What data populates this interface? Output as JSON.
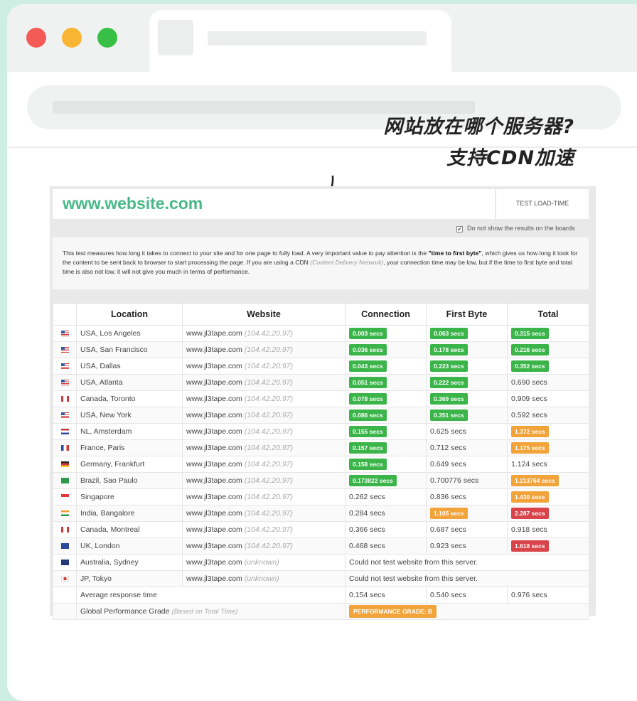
{
  "overlay": {
    "line1": "网站放在哪个服务器?",
    "line2": "支持CDN加速"
  },
  "panel": {
    "site_title": "www.website.com",
    "test_button": "TEST LOAD-TIME",
    "checkbox_label": "Do not show the results on the boards",
    "checkbox_checked": true,
    "info_pre": "This test measures how long it takes to connect to your site and for one page to fully load. A very important value to pay attention is the ",
    "info_bold": "\"time to first byte\"",
    "info_mid": ", which gives us how long it took for the content to be sent back to browser to start processing the page. If you are using a CDN ",
    "info_italic": "(Content Delivery Network)",
    "info_post": ", your connection time may be low, but if the time to first byte and total time is also not low, it will not give you much in terms of performance."
  },
  "table": {
    "headers": [
      "Location",
      "Website",
      "Connection",
      "First Byte",
      "Total"
    ],
    "rows": [
      {
        "flag": "us",
        "location": "USA, Los Angeles",
        "site": "www.jl3tape.com",
        "ip": "(104.42.20.97)",
        "conn": "0.003 secs",
        "conn_c": "green",
        "fb": "0.063 secs",
        "fb_c": "green",
        "total": "0.315 secs",
        "total_c": "green"
      },
      {
        "flag": "us",
        "location": "USA, San Francisco",
        "site": "www.jl3tape.com",
        "ip": "(104.42.20.97)",
        "conn": "0.036 secs",
        "conn_c": "green",
        "fb": "0.178 secs",
        "fb_c": "green",
        "total": "0.216 secs",
        "total_c": "green"
      },
      {
        "flag": "us",
        "location": "USA, Dallas",
        "site": "www.jl3tape.com",
        "ip": "(104.42.20.97)",
        "conn": "0.043 secs",
        "conn_c": "green",
        "fb": "0.223 secs",
        "fb_c": "green",
        "total": "0.352 secs",
        "total_c": "green"
      },
      {
        "flag": "us",
        "location": "USA, Atlanta",
        "site": "www.jl3tape.com",
        "ip": "(104.42.20.97)",
        "conn": "0.051 secs",
        "conn_c": "green",
        "fb": "0.222 secs",
        "fb_c": "green",
        "total": "0.690 secs",
        "total_c": ""
      },
      {
        "flag": "ca",
        "location": "Canada, Toronto",
        "site": "www.jl3tape.com",
        "ip": "(104.42.20.97)",
        "conn": "0.078 secs",
        "conn_c": "green",
        "fb": "0.369 secs",
        "fb_c": "green",
        "total": "0.909 secs",
        "total_c": ""
      },
      {
        "flag": "us",
        "location": "USA, New York",
        "site": "www.jl3tape.com",
        "ip": "(104.42.20.97)",
        "conn": "0.086 secs",
        "conn_c": "green",
        "fb": "0.351 secs",
        "fb_c": "green",
        "total": "0.592 secs",
        "total_c": ""
      },
      {
        "flag": "nl",
        "location": "NL, Amsterdam",
        "site": "www.jl3tape.com",
        "ip": "(104.42.20.97)",
        "conn": "0.155 secs",
        "conn_c": "green",
        "fb": "0.625 secs",
        "fb_c": "",
        "total": "1.372 secs",
        "total_c": "orange"
      },
      {
        "flag": "fr",
        "location": "France, Paris",
        "site": "www.jl3tape.com",
        "ip": "(104.42.20.97)",
        "conn": "0.157 secs",
        "conn_c": "green",
        "fb": "0.712 secs",
        "fb_c": "",
        "total": "1.175 secs",
        "total_c": "orange"
      },
      {
        "flag": "de",
        "location": "Germany, Frankfurt",
        "site": "www.jl3tape.com",
        "ip": "(104.42.20.97)",
        "conn": "0.158 secs",
        "conn_c": "green",
        "fb": "0.649 secs",
        "fb_c": "",
        "total": "1.124 secs",
        "total_c": ""
      },
      {
        "flag": "br",
        "location": "Brazil, Sao Paulo",
        "site": "www.jl3tape.com",
        "ip": "(104.42.20.97)",
        "conn": "0.173822 secs",
        "conn_c": "green",
        "fb": "0.700776 secs",
        "fb_c": "",
        "total": "1.213764 secs",
        "total_c": "orange"
      },
      {
        "flag": "sg",
        "location": "Singapore",
        "site": "www.jl3tape.com",
        "ip": "(104.42.20.97)",
        "conn": "0.262 secs",
        "conn_c": "",
        "fb": "0.836 secs",
        "fb_c": "",
        "total": "1.430 secs",
        "total_c": "orange"
      },
      {
        "flag": "in",
        "location": "India, Bangalore",
        "site": "www.jl3tape.com",
        "ip": "(104.42.20.97)",
        "conn": "0.284 secs",
        "conn_c": "",
        "fb": "1.105 secs",
        "fb_c": "orange",
        "total": "2.287 secs",
        "total_c": "red"
      },
      {
        "flag": "ca",
        "location": "Canada, Montreal",
        "site": "www.jl3tape.com",
        "ip": "(104.42.20.97)",
        "conn": "0.366 secs",
        "conn_c": "",
        "fb": "0.687 secs",
        "fb_c": "",
        "total": "0.918 secs",
        "total_c": ""
      },
      {
        "flag": "uk",
        "location": "UK, London",
        "site": "www.jl3tape.com",
        "ip": "(104.42.20.97)",
        "conn": "0.468 secs",
        "conn_c": "",
        "fb": "0.923 secs",
        "fb_c": "",
        "total": "1.618 secs",
        "total_c": "red"
      }
    ],
    "failed_rows": [
      {
        "flag": "au",
        "location": "Australia, Sydney",
        "site": "www.jl3tape.com",
        "ip": "(unknown)",
        "message": "Could not test website from this server."
      },
      {
        "flag": "jp",
        "location": "JP, Tokyo",
        "site": "www.jl3tape.com",
        "ip": "(unknown)",
        "message": "Could not test website from this server."
      }
    ],
    "average": {
      "label": "Average response time",
      "conn": "0.154 secs",
      "fb": "0.540 secs",
      "total": "0.976 secs"
    },
    "grade": {
      "label": "Global Performance Grade",
      "note": "(Based on Total Time)",
      "badge": "PERFORMANCE GRADE: B"
    }
  },
  "colors": {
    "green": "#3bb54a",
    "orange": "#f2a33a",
    "red": "#d9434a",
    "brand": "#48b888",
    "background": "#cfeee3"
  },
  "icons": [
    "traffic-light-close-icon",
    "traffic-light-minimize-icon",
    "traffic-light-maximize-icon",
    "hand-drawn-arrow-icon",
    "checkbox-check-icon",
    "country-flag-icon"
  ]
}
